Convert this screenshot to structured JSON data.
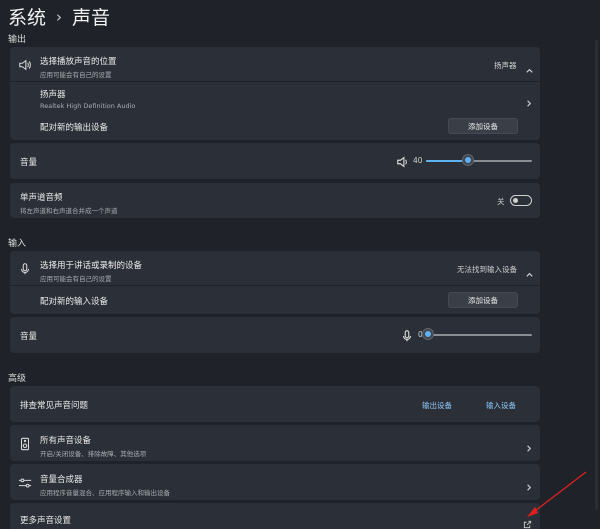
{
  "breadcrumb": {
    "parent": "系统",
    "separator": "›",
    "current": "声音"
  },
  "output": {
    "section_label": "输出",
    "choose_device": {
      "title": "选择播放声音的位置",
      "subtitle": "应用可能会有自己的设置",
      "value": "扬声器"
    },
    "speaker": {
      "title": "扬声器",
      "subtitle": "Realtek High Definition Audio"
    },
    "pair": {
      "title": "配对新的输出设备",
      "button": "添加设备"
    },
    "volume": {
      "title": "音量",
      "value": "40",
      "level_percent": 40
    },
    "mono": {
      "title": "单声道音频",
      "subtitle": "将左声道和右声道合并成一个声道",
      "state": "关"
    }
  },
  "input": {
    "section_label": "输入",
    "choose_device": {
      "title": "选择用于讲话或录制的设备",
      "subtitle": "应用可能会有自己的设置",
      "value": "无法找到输入设备"
    },
    "pair": {
      "title": "配对新的输入设备",
      "button": "添加设备"
    },
    "volume": {
      "title": "音量",
      "value": "0",
      "level_percent": 0
    }
  },
  "advanced": {
    "section_label": "高级",
    "troubleshoot": {
      "title": "排查常见声音问题",
      "link_output": "输出设备",
      "link_input": "输入设备"
    },
    "all_devices": {
      "title": "所有声音设备",
      "subtitle": "开启/关闭设备、排除故障、其他选项"
    },
    "mixer": {
      "title": "音量合成器",
      "subtitle": "应用程序音量混合、应用程序输入和输出设备"
    },
    "more": {
      "title": "更多声音设置"
    }
  },
  "colors": {
    "accent": "#5fb2f2",
    "annotation": "#e02020"
  }
}
